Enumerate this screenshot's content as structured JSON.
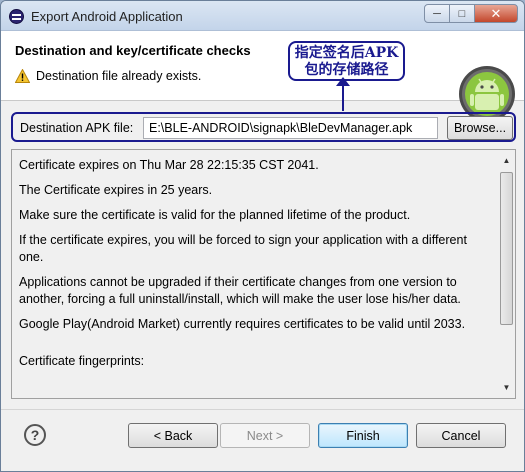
{
  "window": {
    "title": "Export Android Application",
    "controls": {
      "minimize": "─",
      "maximize": "□",
      "close": "✕"
    }
  },
  "header": {
    "title": "Destination and key/certificate checks",
    "warning": "Destination file already exists.",
    "warning_icon": "warning-icon",
    "logo_icon": "android-icon"
  },
  "annotation": {
    "line1": "指定签名后APK",
    "line2": "包的存储路径"
  },
  "destination": {
    "label": "Destination APK file:",
    "value": "E:\\BLE-ANDROID\\signapk\\BleDevManager.apk",
    "browse_label": "Browse..."
  },
  "info": {
    "lines": [
      "Certificate expires on Thu Mar 28 22:15:35 CST 2041.",
      "The Certificate expires in 25 years.",
      "Make sure the certificate is valid for the planned lifetime of the product.",
      "If the certificate expires, you will be forced to sign your application with a different one.",
      "Applications cannot be upgraded if their certificate changes from one version to another, forcing a full uninstall/install, which will make the user lose his/her data.",
      "Google Play(Android Market) currently requires certificates to be valid until 2033.",
      "Certificate fingerprints:"
    ],
    "scroll_up": "▲",
    "scroll_down": "▼"
  },
  "footer": {
    "help": "?",
    "back": "< Back",
    "next": "Next >",
    "finish": "Finish",
    "cancel": "Cancel"
  },
  "colors": {
    "annotation": "#1a1a8f",
    "android_green": "#8cc63f"
  }
}
